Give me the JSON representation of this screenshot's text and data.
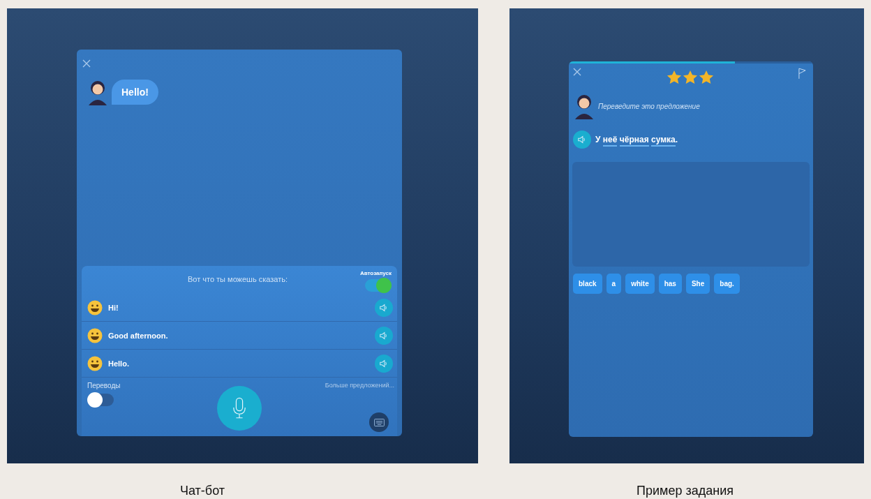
{
  "chat_bot": {
    "bot_message": "Hello!",
    "suggestions": {
      "heading": "Вот что ты можешь сказать:",
      "autostart": {
        "label": "Автозапуск",
        "on": true
      },
      "phrases": [
        {
          "text": "Hi!"
        },
        {
          "text": "Good afternoon."
        },
        {
          "text": "Hello."
        }
      ],
      "translations": {
        "label": "Переводы",
        "on": false
      },
      "more_link": "Больше предложений..."
    }
  },
  "task": {
    "progress": {
      "level": 0.68
    },
    "stars": 3,
    "instruction": "Переведите это предложение",
    "sentence": [
      {
        "kind": "word",
        "text": "У",
        "underlined": false
      },
      {
        "kind": "word",
        "text": "неё",
        "underlined": true
      },
      {
        "kind": "word",
        "text": "чёрная",
        "underlined": true
      },
      {
        "kind": "word",
        "text": "сумка",
        "underlined": true
      },
      {
        "kind": "punctuation",
        "text": ".",
        "underlined": false
      }
    ],
    "word_bank": [
      {
        "text": "black"
      },
      {
        "text": "a"
      },
      {
        "text": "white"
      },
      {
        "text": "has"
      },
      {
        "text": "She"
      },
      {
        "text": "bag."
      }
    ]
  },
  "captions": [
    "Чат-бот",
    "Пример задания"
  ]
}
